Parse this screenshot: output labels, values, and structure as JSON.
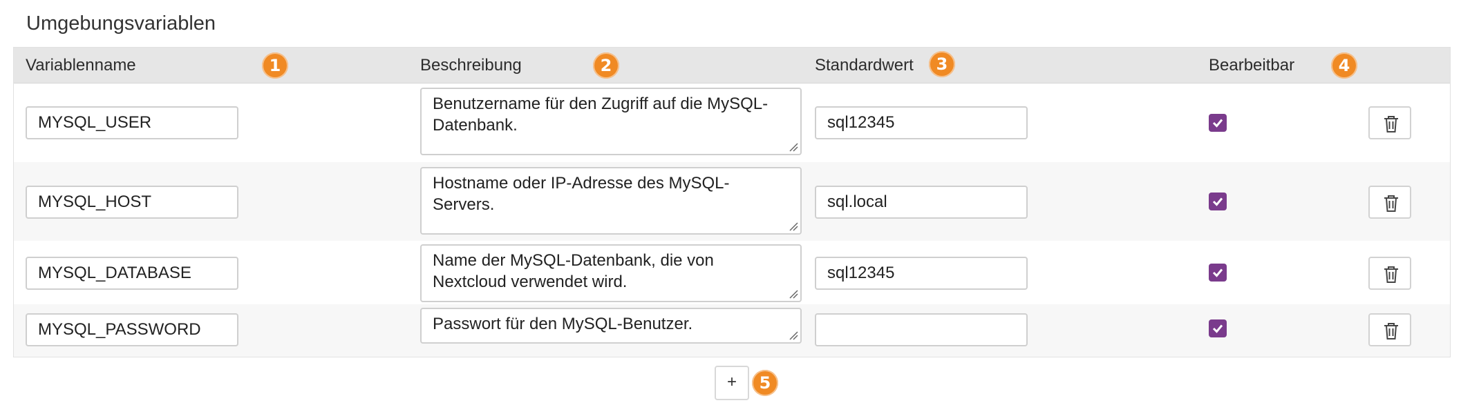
{
  "section": {
    "title": "Umgebungsvariablen"
  },
  "columns": [
    {
      "label": "Variablenname",
      "badge": "1"
    },
    {
      "label": "Beschreibung",
      "badge": "2"
    },
    {
      "label": "Standardwert",
      "badge": "3"
    },
    {
      "label": "Bearbeitbar",
      "badge": "4"
    }
  ],
  "rows": [
    {
      "name": "MYSQL_USER",
      "description": "Benutzername für den Zugriff auf die MySQL-Datenbank.",
      "default_value": "sql12345",
      "editable": true
    },
    {
      "name": "MYSQL_HOST",
      "description": "Hostname oder IP-Adresse des MySQL-Servers.",
      "default_value": "sql.local",
      "editable": true
    },
    {
      "name": "MYSQL_DATABASE",
      "description": "Name der MySQL-Datenbank, die von Nextcloud verwendet wird.",
      "default_value": "sql12345",
      "editable": true
    },
    {
      "name": "MYSQL_PASSWORD",
      "description": "Passwort für den MySQL-Benutzer.",
      "default_value": "",
      "editable": true
    }
  ],
  "add_button": {
    "label": "+",
    "badge": "5"
  },
  "colors": {
    "accent_badge": "#f08a24",
    "checkbox": "#7a3b8c",
    "header_bg": "#e6e6e6"
  },
  "icons": {
    "delete": "trash-icon",
    "checked": "checkmark-icon",
    "resize": "resize-handle-icon"
  }
}
